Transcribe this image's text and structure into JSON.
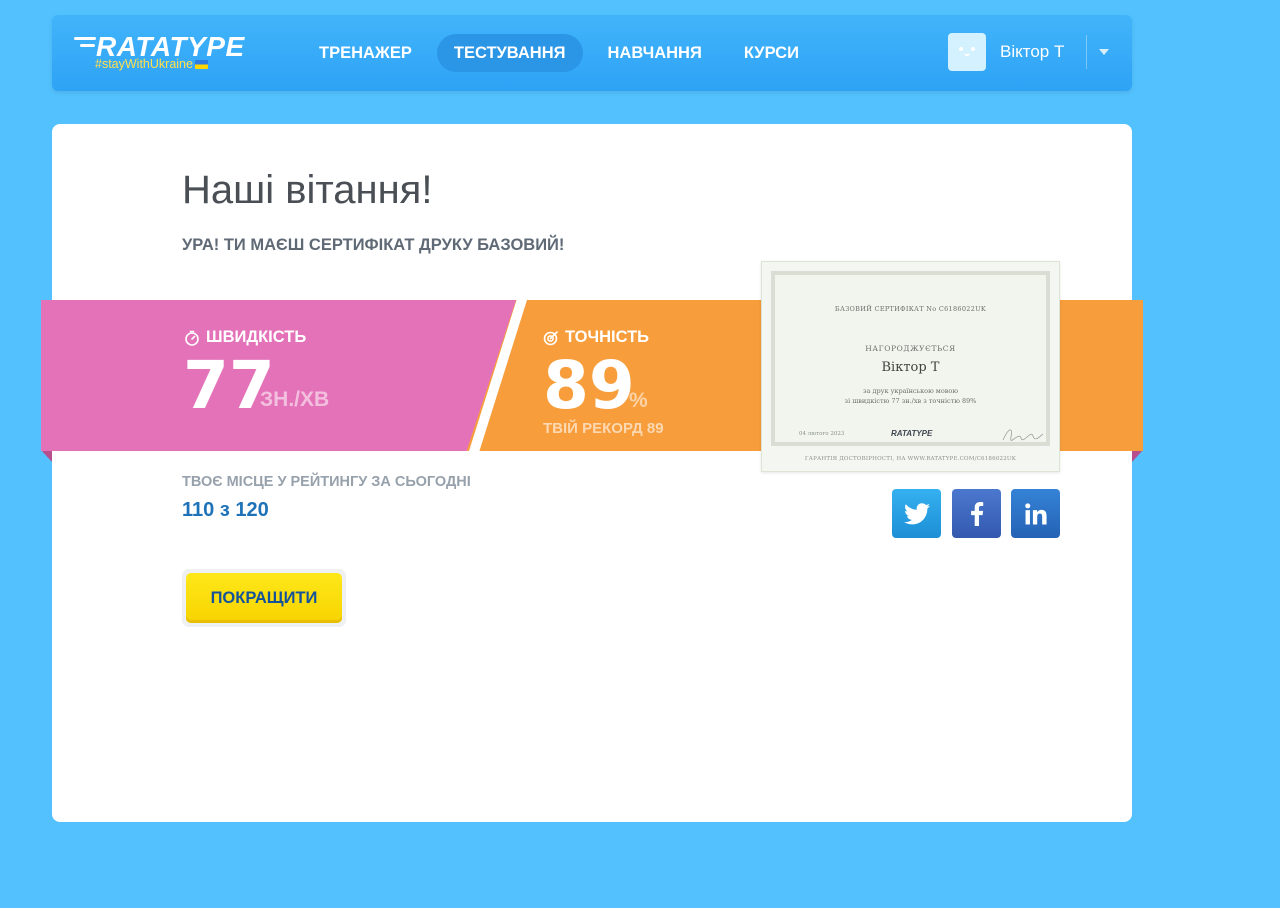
{
  "brand": {
    "name": "RATATYPE",
    "tagline": "#stayWithUkraine"
  },
  "nav": {
    "items": [
      {
        "label": "ТРЕНАЖЕР",
        "active": false
      },
      {
        "label": "ТЕСТУВАННЯ",
        "active": true
      },
      {
        "label": "НАВЧАННЯ",
        "active": false
      },
      {
        "label": "КУРСИ",
        "active": false
      }
    ]
  },
  "user": {
    "name": "Віктор Т"
  },
  "result": {
    "title": "Наші вітання!",
    "subtitle": "УРА! ТИ МАЄШ СЕРТИФІКАТ ДРУКУ БАЗОВИЙ!",
    "speed": {
      "label": "ШВИДКІСТЬ",
      "value": "77",
      "unit": "ЗН./ХВ"
    },
    "accuracy": {
      "label": "ТОЧНІСТЬ",
      "value": "89",
      "unit": "%",
      "record": "ТВІЙ РЕКОРД 89"
    },
    "rating": {
      "label": "ТВОЄ МІСЦЕ У РЕЙТИНГУ ЗА СЬОГОДНІ",
      "value": "110 з 120"
    },
    "improve_label": "ПОКРАЩИТИ"
  },
  "certificate": {
    "header": "БАЗОВИЙ СЕРТИФІКАТ No C6186022UK",
    "award": "НАГОРОДЖУЄТЬСЯ",
    "name": "Віктор Т",
    "line1": "за друк українською мовою",
    "line2": "зі швидкістю 77 зн./хв з точністю 89%",
    "date": "04 лютого 2023",
    "logo": "RATATYPE",
    "footer": "ГАРАНТІЯ ДОСТОВІРНОСТІ, НА WWW.RATATYPE.COM/C6186022UK"
  },
  "share": {
    "icons": [
      "twitter-icon",
      "facebook-icon",
      "linkedin-icon"
    ]
  },
  "colors": {
    "background": "#52c1fd",
    "speed_band": "#e472b8",
    "accuracy_band": "#f79d3b",
    "improve_button": "#ffe000",
    "rating_value": "#1e73b8"
  }
}
